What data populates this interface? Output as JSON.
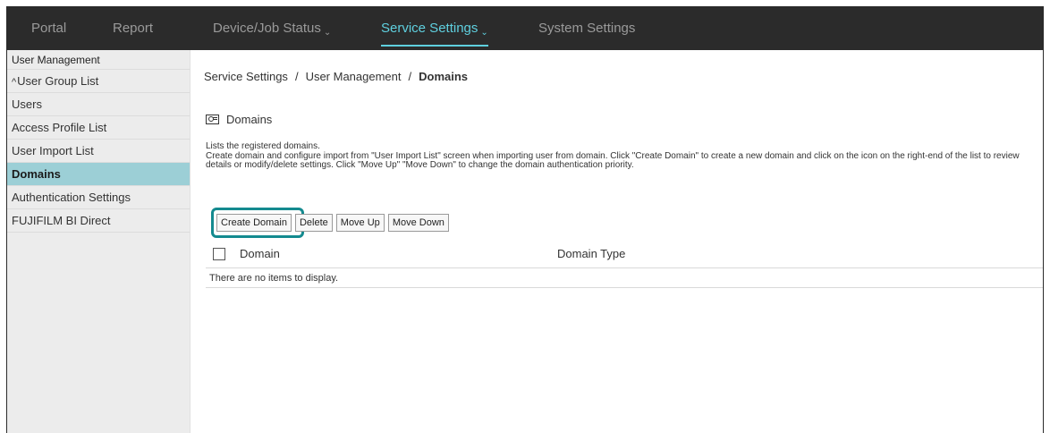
{
  "topnav": {
    "items": [
      {
        "label": "Portal"
      },
      {
        "label": "Report"
      },
      {
        "label": "Device/Job Status",
        "chevron": "⌄"
      },
      {
        "label": "Service Settings",
        "chevron": "⌄"
      },
      {
        "label": "System Settings"
      }
    ],
    "active_color": "#5fd0df"
  },
  "sidebar": {
    "title": "User Management",
    "group_caret": "^",
    "group_label": "User Group List",
    "items": [
      {
        "label": "Users"
      },
      {
        "label": "Access Profile List"
      },
      {
        "label": "User Import List"
      },
      {
        "label": "Domains"
      },
      {
        "label": "Authentication Settings"
      },
      {
        "label": "FUJIFILM BI Direct"
      }
    ],
    "active_bg": "#9ccfd6"
  },
  "breadcrumb": {
    "parts": [
      "Service Settings",
      "User Management",
      "Domains"
    ],
    "sep": "/"
  },
  "section": {
    "icon": "domain-card-icon",
    "title": "Domains"
  },
  "description": {
    "line1": "Lists the registered domains.",
    "line2": "Create domain and configure import from \"User Import List\" screen when importing user from domain. Click \"Create Domain\" to create a new domain and click on the icon on the right-end of the list to review details or modify/delete settings. Click \"Move Up\" \"Move Down\" to change the domain authentication priority."
  },
  "buttons": {
    "create": "Create Domain",
    "delete": "Delete",
    "move_up": "Move Up",
    "move_down": "Move Down",
    "highlight_color": "#148a8f"
  },
  "table": {
    "columns": [
      "Domain",
      "Domain Type"
    ],
    "empty_message": "There are no items to display."
  }
}
